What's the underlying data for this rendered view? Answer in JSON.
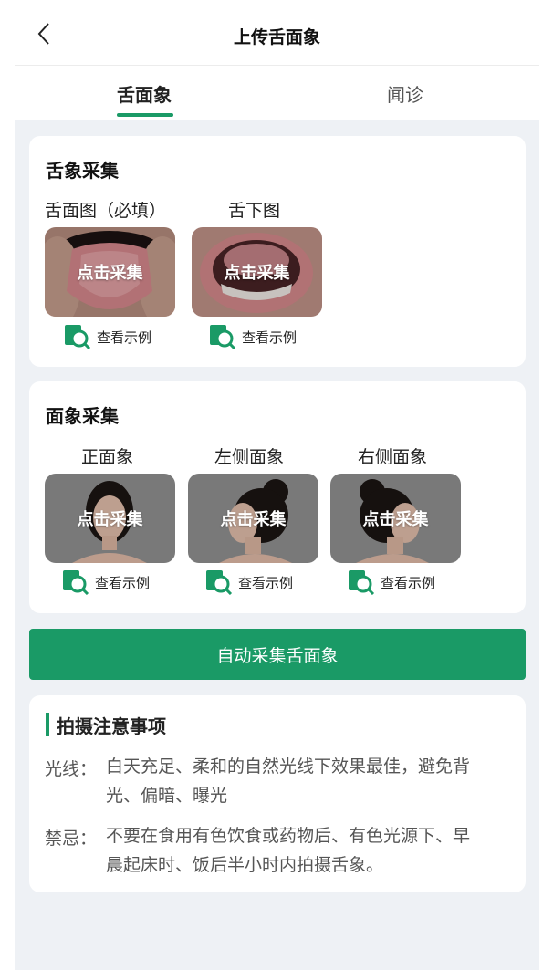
{
  "header": {
    "title": "上传舌面象"
  },
  "tabs": [
    {
      "label": "舌面象",
      "active": true
    },
    {
      "label": "闻诊",
      "active": false
    }
  ],
  "tongue_section": {
    "title": "舌象采集",
    "slots": [
      {
        "label": "舌面图（必填）",
        "action": "点击采集",
        "example": "查看示例"
      },
      {
        "label": "舌下图",
        "action": "点击采集",
        "example": "查看示例"
      }
    ]
  },
  "face_section": {
    "title": "面象采集",
    "slots": [
      {
        "label": "正面象",
        "action": "点击采集",
        "example": "查看示例"
      },
      {
        "label": "左侧面象",
        "action": "点击采集",
        "example": "查看示例"
      },
      {
        "label": "右侧面象",
        "action": "点击采集",
        "example": "查看示例"
      }
    ]
  },
  "auto_button": {
    "label": "自动采集舌面象"
  },
  "notes": {
    "title": "拍摄注意事项",
    "items": [
      {
        "label": "光线：",
        "lines": [
          "白天充足、柔和的自然光线下效果最佳，避免背",
          "光、偏暗、曝光"
        ]
      },
      {
        "label": "禁忌：",
        "lines": [
          "不要在食用有色饮食或药物后、有色光源下、早",
          "晨起床时、饭后半小时内拍摄舌象。"
        ]
      }
    ]
  },
  "colors": {
    "accent": "#1a9a66",
    "background": "#eef1f5"
  }
}
